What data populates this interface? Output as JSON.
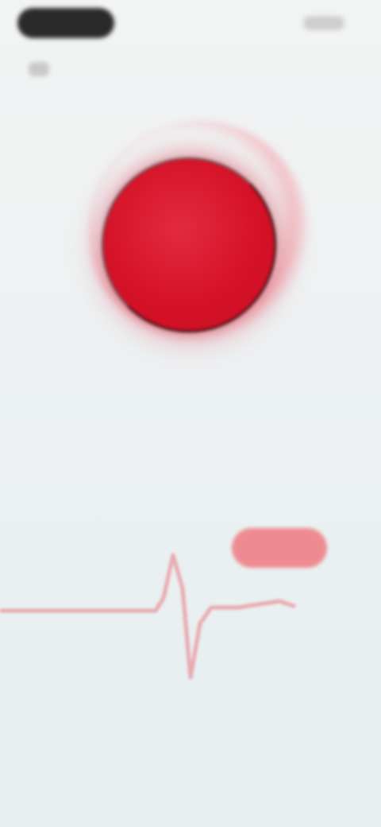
{
  "status_bar": {
    "time": "",
    "right_text": ""
  },
  "header": {
    "left_text": ""
  },
  "main": {
    "circle_label": "",
    "circle_sublabel": "",
    "caption": ""
  },
  "actions": {
    "pill_button_label": ""
  },
  "colors": {
    "primary_red": "#d51227",
    "pill": "#ee8b92",
    "wave": "#e8aab0"
  }
}
